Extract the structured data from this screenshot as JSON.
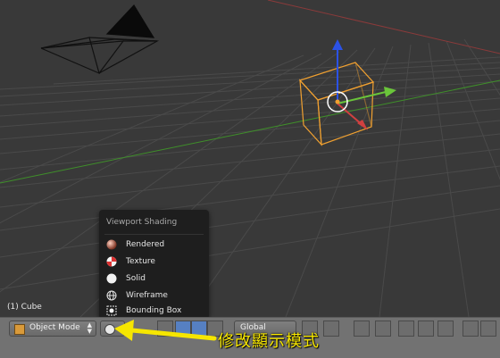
{
  "viewport": {
    "object_label": "(1) Cube"
  },
  "shading_menu": {
    "title": "Viewport Shading",
    "items": [
      {
        "label": "Rendered",
        "icon": "rendered-sphere-icon"
      },
      {
        "label": "Texture",
        "icon": "texture-checker-icon"
      },
      {
        "label": "Solid",
        "icon": "solid-sphere-icon"
      },
      {
        "label": "Wireframe",
        "icon": "wireframe-globe-icon"
      },
      {
        "label": "Bounding Box",
        "icon": "bounding-box-icon"
      }
    ]
  },
  "header": {
    "mode": "Object Mode",
    "pivot_label": "Global"
  },
  "annotation": {
    "text": "修改顯示模式",
    "color": "#f6e600"
  },
  "colors": {
    "background": "#393939",
    "grid": "#4a4a4a",
    "x_axis": "#d04040",
    "y_axis": "#6ac53a",
    "selection": "#f0a030",
    "manip_z": "#2b52e6",
    "active_button": "#5680c2"
  }
}
